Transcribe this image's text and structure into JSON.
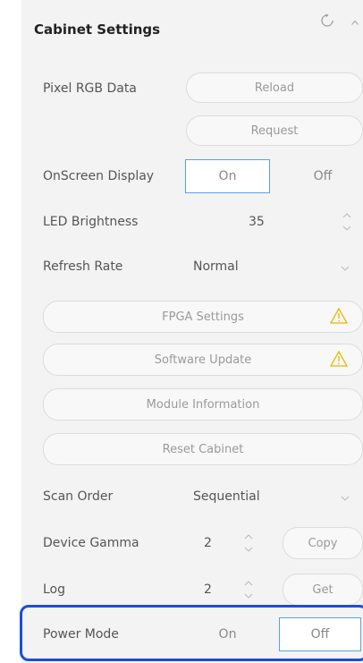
{
  "header": {
    "title": "Cabinet Settings",
    "refresh_icon": "refresh-icon",
    "collapse_icon": "chevron-up-icon"
  },
  "pixel_rgb": {
    "label": "Pixel RGB Data",
    "reload_label": "Reload",
    "request_label": "Request"
  },
  "osd": {
    "label": "OnScreen Display",
    "on_label": "On",
    "off_label": "Off",
    "selected": "On"
  },
  "brightness": {
    "label": "LED Brightness",
    "value": "35"
  },
  "refresh_rate": {
    "label": "Refresh Rate",
    "value": "Normal"
  },
  "actions": {
    "fpga": "FPGA Settings",
    "software": "Software Update",
    "module": "Module Information",
    "reset": "Reset Cabinet"
  },
  "scan_order": {
    "label": "Scan Order",
    "value": "Sequential"
  },
  "gamma": {
    "label": "Device Gamma",
    "value": "2",
    "button": "Copy"
  },
  "log": {
    "label": "Log",
    "value": "2",
    "button": "Get"
  },
  "power_mode": {
    "label": "Power Mode",
    "on_label": "On",
    "off_label": "Off",
    "selected": "Off"
  },
  "colors": {
    "accent": "#5aa0e6",
    "warning": "#f0b400",
    "highlight": "#1a4fd8"
  }
}
